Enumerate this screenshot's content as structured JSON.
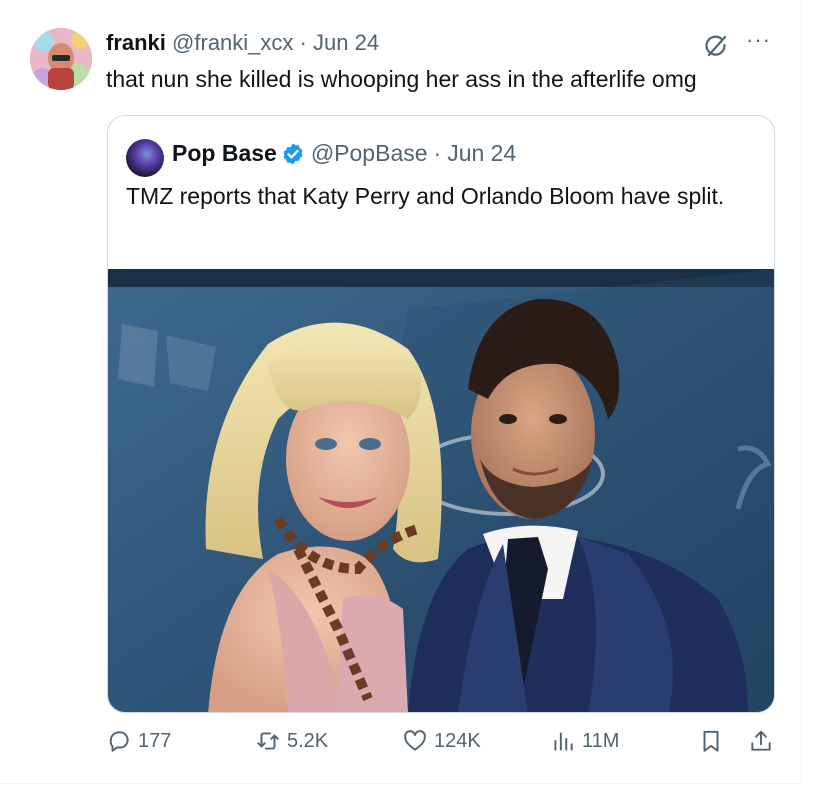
{
  "tweet": {
    "author_name": "franki",
    "author_handle": "@franki_xcx",
    "separator": "·",
    "date": "Jun 24",
    "text": "that nun she killed is whooping her ass in the afterlife omg",
    "more_label": "···"
  },
  "quoted": {
    "author_name": "Pop Base",
    "author_handle": "@PopBase",
    "separator": "·",
    "date": "Jun 24",
    "text": "TMZ reports that Katy Perry and Orlando Bloom have split."
  },
  "actions": {
    "replies": "177",
    "reposts": "5.2K",
    "likes": "124K",
    "views": "11M"
  },
  "icons": {
    "reply": "reply-icon",
    "repost": "repost-icon",
    "like": "heart-icon",
    "views": "views-icon",
    "bookmark": "bookmark-icon",
    "share": "share-icon",
    "grok": "grok-icon",
    "verified": "verified-badge-icon"
  },
  "colors": {
    "text_primary": "#0f1419",
    "text_secondary": "#536471",
    "border": "#cfd9de",
    "verified": "#1d9bf0"
  }
}
